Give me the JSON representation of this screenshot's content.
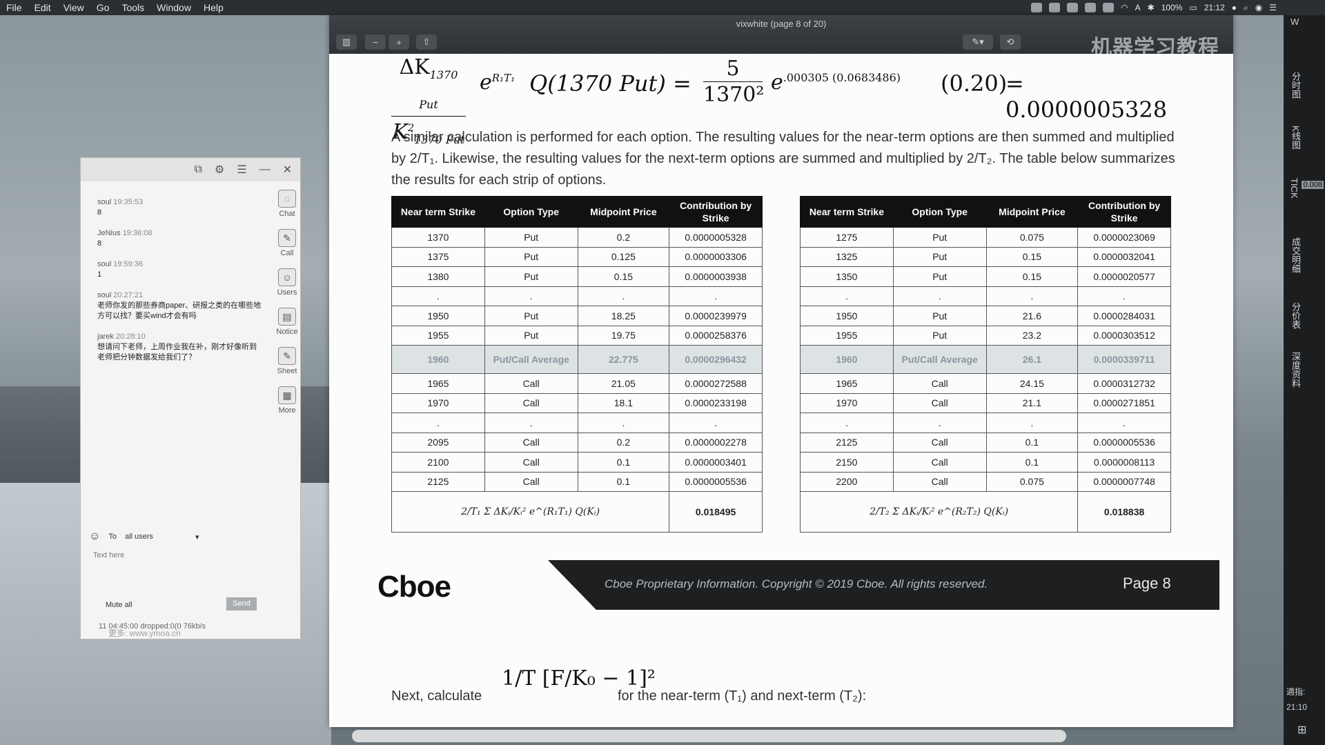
{
  "menubar": {
    "items": [
      "File",
      "Edit",
      "View",
      "Go",
      "Tools",
      "Window",
      "Help"
    ],
    "battery": "100%",
    "time": "21:12"
  },
  "preview": {
    "title": "vixwhite (page 8 of 20)",
    "watermark": "机器学习教程"
  },
  "formula": {
    "lhs_num": "ΔK",
    "lhs_num_sub": "1370 Put",
    "lhs_den": "K",
    "lhs_den_sub": "1370 Put",
    "e1": "e",
    "e1_exp": "R₁T₁",
    "q": "Q(1370 Put) =",
    "rhs_num": "5",
    "rhs_den": "1370²",
    "e2": "e",
    "e2_exp": ".000305  (0.0683486)",
    "factor": "(0.20)",
    "result": "= 0.0000005328"
  },
  "paragraph": "A similar calculation is performed for each option.  The resulting values for the near-term options are then summed and multiplied by 2/T₁.  Likewise, the resulting values for the next-term options are summed and multiplied by 2/T₂.  The table below summarizes the results for each strip of options.",
  "table_near": {
    "headers": [
      "Near term Strike",
      "Option Type",
      "Midpoint Price",
      "Contribution by Strike"
    ],
    "rows": [
      [
        "1370",
        "Put",
        "0.2",
        "0.0000005328"
      ],
      [
        "1375",
        "Put",
        "0.125",
        "0.0000003306"
      ],
      [
        "1380",
        "Put",
        "0.15",
        "0.0000003938"
      ],
      [
        ".",
        ".",
        ".",
        "."
      ],
      [
        "1950",
        "Put",
        "18.25",
        "0.0000239979"
      ],
      [
        "1955",
        "Put",
        "19.75",
        "0.0000258376"
      ],
      [
        "1960",
        "Put/Call Average",
        "22.775",
        "0.0000296432"
      ],
      [
        "1965",
        "Call",
        "21.05",
        "0.0000272588"
      ],
      [
        "1970",
        "Call",
        "18.1",
        "0.0000233198"
      ],
      [
        ".",
        ".",
        ".",
        "."
      ],
      [
        "2095",
        "Call",
        "0.2",
        "0.0000002278"
      ],
      [
        "2100",
        "Call",
        "0.1",
        "0.0000003401"
      ],
      [
        "2125",
        "Call",
        "0.1",
        "0.0000005536"
      ]
    ],
    "sum_expr": "2/T₁ Σ ΔKᵢ/Kᵢ² e^(R₁T₁) Q(Kᵢ)",
    "sum_value": "0.018495"
  },
  "table_next": {
    "headers": [
      "Near term Strike",
      "Option Type",
      "Midpoint Price",
      "Contribution by Strike"
    ],
    "rows": [
      [
        "1275",
        "Put",
        "0.075",
        "0.0000023069"
      ],
      [
        "1325",
        "Put",
        "0.15",
        "0.0000032041"
      ],
      [
        "1350",
        "Put",
        "0.15",
        "0.0000020577"
      ],
      [
        ".",
        ".",
        ".",
        "."
      ],
      [
        "1950",
        "Put",
        "21.6",
        "0.0000284031"
      ],
      [
        "1955",
        "Put",
        "23.2",
        "0.0000303512"
      ],
      [
        "1960",
        "Put/Call Average",
        "26.1",
        "0.0000339711"
      ],
      [
        "1965",
        "Call",
        "24.15",
        "0.0000312732"
      ],
      [
        "1970",
        "Call",
        "21.1",
        "0.0000271851"
      ],
      [
        ".",
        ".",
        ".",
        "."
      ],
      [
        "2125",
        "Call",
        "0.1",
        "0.0000005536"
      ],
      [
        "2150",
        "Call",
        "0.1",
        "0.0000008113"
      ],
      [
        "2200",
        "Call",
        "0.075",
        "0.0000007748"
      ]
    ],
    "sum_expr": "2/T₂ Σ ΔKᵢ/Kᵢ² e^(R₂T₂) Q(Kᵢ)",
    "sum_value": "0.018838"
  },
  "footer": {
    "logo": "Cboe",
    "copyright": "Cboe Proprietary Information. Copyright © 2019 Cboe.  All rights reserved.",
    "page": "Page 8"
  },
  "next": {
    "text_before": "Next, calculate",
    "formula": "1/T [F/K₀ − 1]²",
    "text_after": "for the near-term (T₁) and next-term (T₂):"
  },
  "chat": {
    "messages": [
      {
        "user": "soul",
        "time": "19:35:53",
        "body": "8"
      },
      {
        "user": "JeNius",
        "time": "19:36:08",
        "body": "8"
      },
      {
        "user": "soul",
        "time": "19:59:36",
        "body": "1"
      },
      {
        "user": "soul",
        "time": "20:27:21",
        "body": "老师你发的那些券商paper、研报之类的在哪些地方可以找？要买wind才会有吗"
      },
      {
        "user": "jarek",
        "time": "20:28:10",
        "body": "想请问下老师，上周作业我在补，刚才好像听到老师把分钟数据发给我们了？"
      }
    ],
    "side": [
      "Chat",
      "Call",
      "Users",
      "Notice",
      "Sheet",
      "More"
    ],
    "to_label": "To",
    "to_value": "all users",
    "placeholder": "Text here",
    "mute": "Mute all",
    "send": "Send",
    "status": "11  04:45:00  dropped:0(0   76kb/s",
    "status_wm": "更多: www.ymoa.cn"
  },
  "rstrip": {
    "labels": [
      "分时图",
      "K线图",
      "TICK",
      "成交明细",
      "分价表",
      "深度资料"
    ],
    "price": "0.008",
    "bottom": "適指:",
    "time": "21:10"
  }
}
